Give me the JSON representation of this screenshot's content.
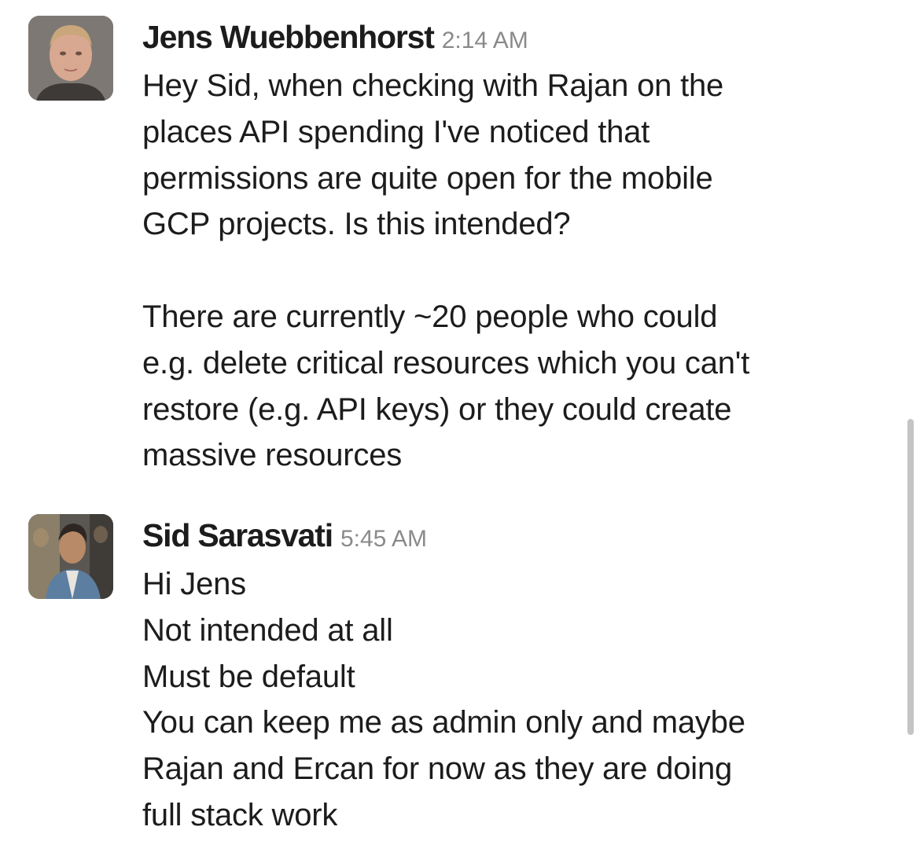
{
  "messages": [
    {
      "author": "Jens Wuebbenhorst",
      "time": "2:14 AM",
      "avatar_icon": "user-avatar-icon",
      "lines": [
        "Hey Sid, when checking with Rajan on the",
        "places API spending I've noticed that",
        "permissions are quite open for the mobile",
        "GCP projects. Is this intended?",
        "",
        "There are currently ~20 people who could",
        "e.g. delete critical resources which you can't",
        "restore (e.g. API keys) or they could create",
        "massive resources"
      ]
    },
    {
      "author": "Sid Sarasvati",
      "time": "5:45 AM",
      "avatar_icon": "user-avatar-icon",
      "lines": [
        "Hi Jens",
        "Not intended at all",
        "Must be default",
        "You can keep me as admin only and maybe",
        "Rajan and Ercan for now as they are doing",
        "full stack work"
      ]
    }
  ],
  "colors": {
    "text": "#1d1c1d",
    "timestamp": "#8a8a8a",
    "scrollbar": "#c4c4c4",
    "background": "#ffffff"
  }
}
